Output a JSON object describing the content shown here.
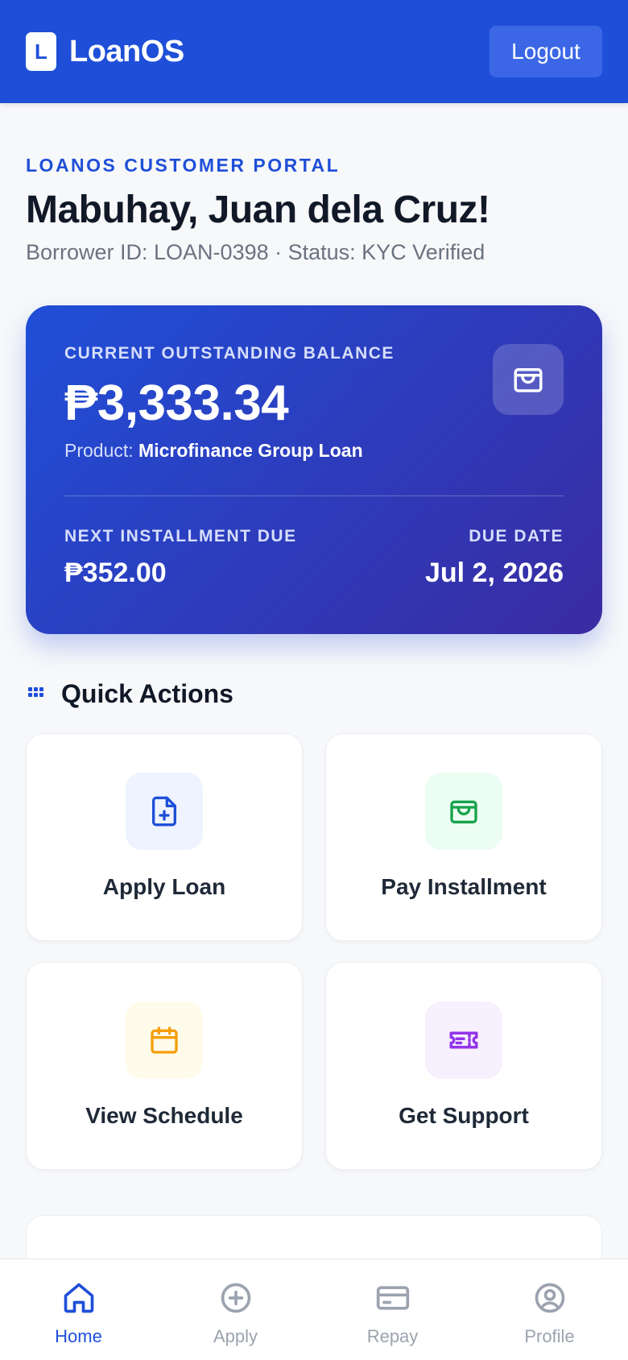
{
  "header": {
    "logo_letter": "L",
    "brand": "LoanOS",
    "logout_label": "Logout"
  },
  "intro": {
    "eyebrow": "LOANOS CUSTOMER PORTAL",
    "greeting": "Mabuhay, Juan dela Cruz!",
    "borrower_line": "Borrower ID: LOAN-0398 · Status: KYC Verified"
  },
  "balance": {
    "label": "CURRENT OUTSTANDING BALANCE",
    "amount": "₱3,333.34",
    "product_prefix": "Product:",
    "product_name": "Microfinance Group Loan",
    "next_label": "NEXT INSTALLMENT DUE",
    "next_amount": "₱352.00",
    "due_label": "DUE DATE",
    "due_date": "Jul 2, 2026",
    "icon": "wallet-icon"
  },
  "quick_actions": {
    "title": "Quick Actions",
    "items": [
      {
        "label": "Apply Loan",
        "icon": "file-plus-icon",
        "color": "#1f4fd8",
        "bg": "#eef3ff"
      },
      {
        "label": "Pay Installment",
        "icon": "wallet-icon",
        "color": "#16a34a",
        "bg": "#ecfdf3"
      },
      {
        "label": "View Schedule",
        "icon": "calendar-icon",
        "color": "#f59e0b",
        "bg": "#fffbeb"
      },
      {
        "label": "Get Support",
        "icon": "ticket-icon",
        "color": "#9333ea",
        "bg": "#f7f0ff"
      }
    ]
  },
  "nav": {
    "items": [
      {
        "label": "Home",
        "icon": "home-icon",
        "active": true
      },
      {
        "label": "Apply",
        "icon": "plus-circle-icon",
        "active": false
      },
      {
        "label": "Repay",
        "icon": "credit-card-icon",
        "active": false
      },
      {
        "label": "Profile",
        "icon": "user-circle-icon",
        "active": false
      }
    ]
  },
  "colors": {
    "primary": "#1f4fd8",
    "card_gradient_end": "#3a2ba2"
  }
}
